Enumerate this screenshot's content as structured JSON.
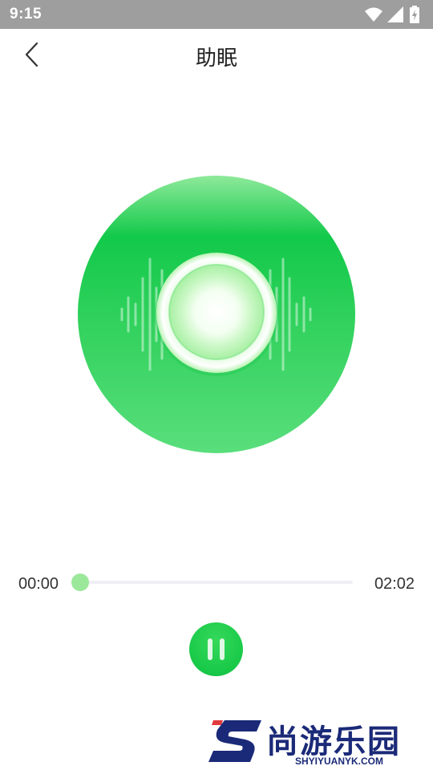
{
  "status_bar": {
    "time": "9:15",
    "icons": [
      "wifi-icon",
      "signal-icon",
      "battery-charging-icon"
    ]
  },
  "header": {
    "title": "助眠",
    "back_icon": "chevron-left-icon"
  },
  "player": {
    "disc_colors": {
      "outer": "#3dd864",
      "inner_glow": "#ffffff"
    }
  },
  "progress": {
    "current_time": "00:00",
    "total_time": "02:02",
    "fraction": 0.0,
    "color": "#9be89a"
  },
  "controls": {
    "pause_icon": "pause-icon",
    "color": "#18c948"
  },
  "watermark": {
    "text": "尚游乐园",
    "url": "SHYIYUANYK.COM",
    "color": "#1b2a78"
  }
}
